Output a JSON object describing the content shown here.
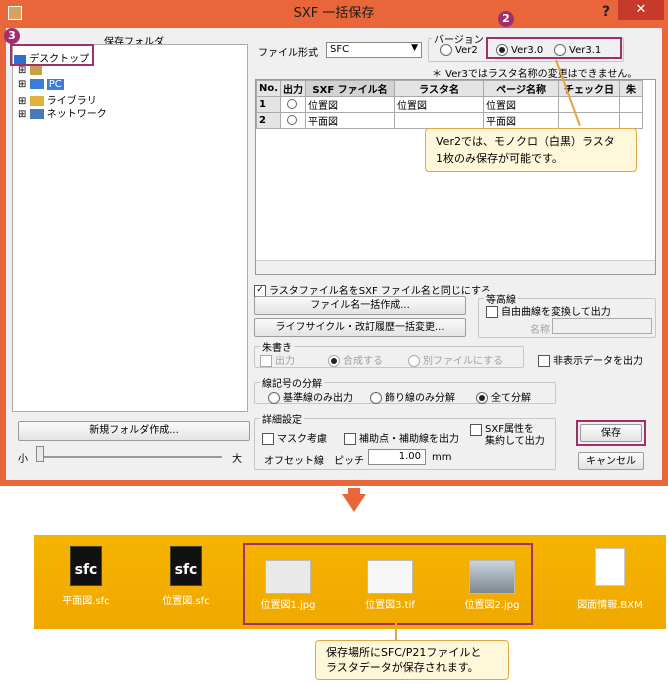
{
  "window": {
    "title": "SXF 一括保存",
    "help": "?",
    "close": "✕"
  },
  "left": {
    "folder_label": "保存フォルダ",
    "tree": [
      {
        "label": "デスクトップ",
        "expander": ""
      },
      {
        "label": "",
        "expander": "⊞"
      },
      {
        "label": "PC",
        "expander": "⊞"
      },
      {
        "label": "ライブラリ",
        "expander": "⊞"
      },
      {
        "label": "ネットワーク",
        "expander": "⊞"
      }
    ],
    "new_folder_button": "新規フォルダ作成...",
    "zoom_small": "小",
    "zoom_large": "大"
  },
  "badges": {
    "b2": "2",
    "b3": "3"
  },
  "format": {
    "label": "ファイル形式",
    "value": "SFC"
  },
  "version": {
    "group_label": "バージョン",
    "options": [
      "Ver2",
      "Ver3.0",
      "Ver3.1"
    ],
    "selected": "Ver3.0",
    "note": "＊ Ver3ではラスタ名称の変更はできません。"
  },
  "table": {
    "headers": [
      "No.",
      "出力",
      "SXF ファイル名",
      "ラスタ名",
      "ページ名称",
      "チェック日",
      "朱"
    ],
    "rows": [
      {
        "no": "1",
        "sxf": "位置図",
        "raster": "位置図",
        "page": "位置図"
      },
      {
        "no": "2",
        "sxf": "平面図",
        "raster": "",
        "page": "平面図"
      }
    ]
  },
  "callout1": {
    "line1": "Ver2では、モノクロ（白黒）ラスタ",
    "line2": "1枚のみ保存が可能です。"
  },
  "options": {
    "same_name": "ラスタファイル名をSXF ファイル名と同じにする",
    "bulk_name_button": "ファイル名一括作成...",
    "lifecycle_button": "ライフサイクル・改訂履歴一括変更...",
    "contour_group": "等高線",
    "free_curve": "自由曲線を変換して出力",
    "name_label": "名称",
    "redline_group": "朱書き",
    "redline_output": "出力",
    "redline_merge": "合成する",
    "redline_separate": "別ファイルにする",
    "hidden_data": "非表示データを出力",
    "linetype_group": "線記号の分解",
    "linetype_options": [
      "基準線のみ出力",
      "飾り線のみ分解",
      "全て分解"
    ],
    "linetype_selected": "全て分解",
    "detail_group": "詳細設定",
    "mask": "マスク考慮",
    "aux_lines": "補助点・補助線を出力",
    "sxf_attr_line1": "SXF属性を",
    "sxf_attr_line2": "集約して出力",
    "offset_label": "オフセット線",
    "pitch_label": "ピッチ",
    "pitch_value": "1.00",
    "pitch_unit": "mm"
  },
  "buttons": {
    "save": "保存",
    "cancel": "キャンセル"
  },
  "arrow": "▼",
  "files": [
    {
      "name": "平面図.sfc",
      "kind": "sfc",
      "icon_text": "sfc"
    },
    {
      "name": "位置図.sfc",
      "kind": "sfc",
      "icon_text": "sfc"
    },
    {
      "name": "位置図1.jpg",
      "kind": "image"
    },
    {
      "name": "位置図3.tif",
      "kind": "image"
    },
    {
      "name": "位置図2.jpg",
      "kind": "image"
    },
    {
      "name": "図面情報.BXM",
      "kind": "doc"
    }
  ],
  "callout2": {
    "line1": "保存場所にSFC/P21ファイルと",
    "line2": "ラスタデータが保存されます。"
  },
  "colors": {
    "title_bar": "#e8663a",
    "highlight": "#a0306a",
    "folder_band": "#f0a800",
    "callout_border": "#e8a341"
  }
}
